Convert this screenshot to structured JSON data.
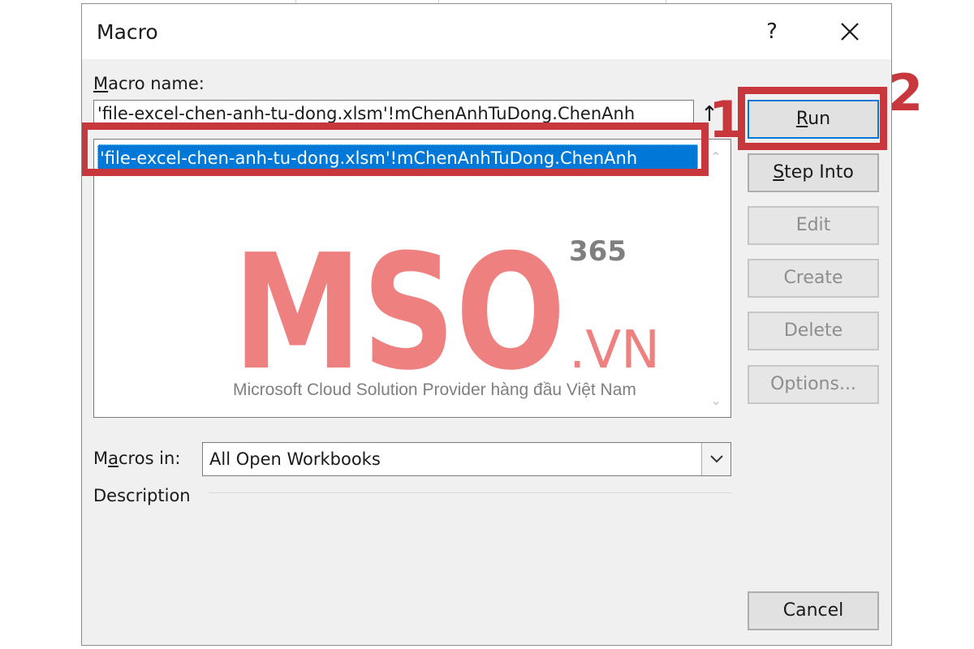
{
  "dialog": {
    "title": "Macro",
    "help_label": "?",
    "close_icon": "close-icon"
  },
  "macro_name": {
    "label_accel": "M",
    "label_rest": "acro name:",
    "value": "'file-excel-chen-anh-tu-dong.xlsm'!mChenAnhTuDong.ChenAnh",
    "items": [
      {
        "label": "'file-excel-chen-anh-tu-dong.xlsm'!mChenAnhTuDong.ChenAnh",
        "selected": true
      }
    ]
  },
  "buttons": {
    "run_accel": "R",
    "run_rest": "un",
    "step_into_accel": "S",
    "step_into_rest": "tep Into",
    "edit": "Edit",
    "create": "Create",
    "delete": "Delete",
    "options": "Options...",
    "cancel": "Cancel"
  },
  "macros_in": {
    "label_pre": "M",
    "label_accel": "a",
    "label_rest": "cros in:",
    "selected": "All Open Workbooks"
  },
  "description": {
    "label": "Description"
  },
  "annotations": {
    "step1": "1",
    "step2": "2",
    "color": "#c8373b"
  },
  "watermark": {
    "brand": "MSO",
    "suffix": ".VN",
    "superscript": "365",
    "tagline": "Microsoft Cloud Solution Provider hàng đầu Việt Nam",
    "color": "#ef8080"
  },
  "colors": {
    "selection": "#0078d7",
    "dialog_bg": "#f0f0f0"
  }
}
